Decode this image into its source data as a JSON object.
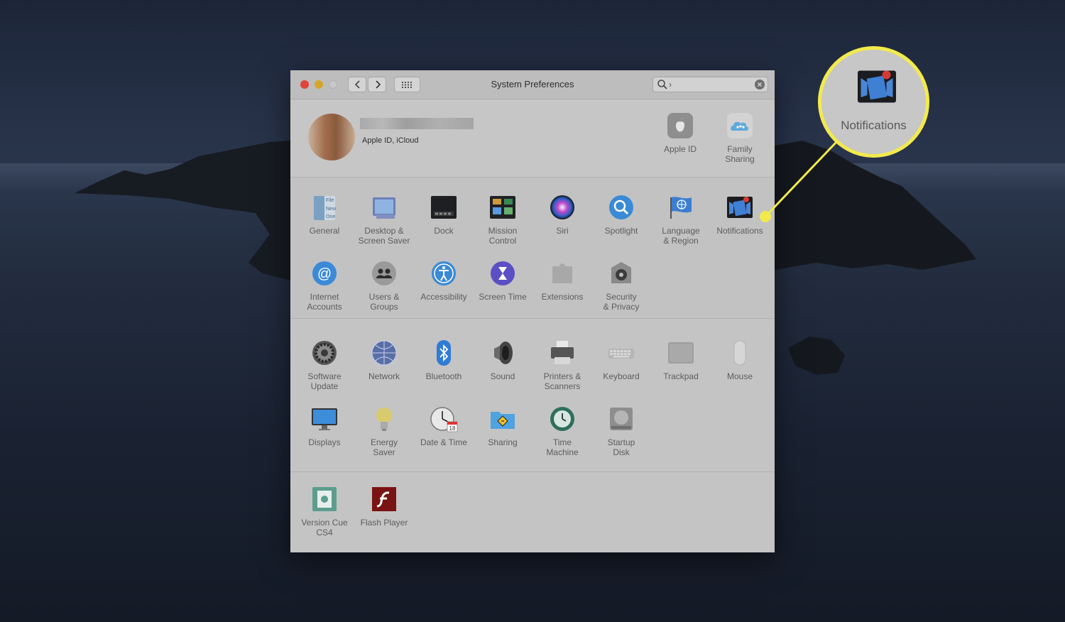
{
  "window": {
    "title": "System Preferences",
    "search_text": "›"
  },
  "account": {
    "subtitle": "Apple ID, iCloud",
    "items": [
      {
        "label": "Apple ID",
        "icon": "apple-logo-icon"
      },
      {
        "label": "Family\nSharing",
        "icon": "family-sharing-cloud-icon"
      }
    ]
  },
  "panes_row1": [
    {
      "label": "General",
      "icon": "general-icon"
    },
    {
      "label": "Desktop &\nScreen Saver",
      "icon": "desktop-screensaver-icon"
    },
    {
      "label": "Dock",
      "icon": "dock-icon"
    },
    {
      "label": "Mission\nControl",
      "icon": "mission-control-icon"
    },
    {
      "label": "Siri",
      "icon": "siri-icon"
    },
    {
      "label": "Spotlight",
      "icon": "spotlight-icon"
    },
    {
      "label": "Language\n& Region",
      "icon": "language-region-icon"
    },
    {
      "label": "Notifications",
      "icon": "notifications-icon"
    }
  ],
  "panes_row2": [
    {
      "label": "Internet\nAccounts",
      "icon": "internet-accounts-icon"
    },
    {
      "label": "Users &\nGroups",
      "icon": "users-groups-icon"
    },
    {
      "label": "Accessibility",
      "icon": "accessibility-icon"
    },
    {
      "label": "Screen Time",
      "icon": "screen-time-icon"
    },
    {
      "label": "Extensions",
      "icon": "extensions-icon"
    },
    {
      "label": "Security\n& Privacy",
      "icon": "security-privacy-icon"
    }
  ],
  "panes_row3": [
    {
      "label": "Software\nUpdate",
      "icon": "software-update-icon"
    },
    {
      "label": "Network",
      "icon": "network-icon"
    },
    {
      "label": "Bluetooth",
      "icon": "bluetooth-icon"
    },
    {
      "label": "Sound",
      "icon": "sound-icon"
    },
    {
      "label": "Printers &\nScanners",
      "icon": "printers-scanners-icon"
    },
    {
      "label": "Keyboard",
      "icon": "keyboard-icon"
    },
    {
      "label": "Trackpad",
      "icon": "trackpad-icon"
    },
    {
      "label": "Mouse",
      "icon": "mouse-icon"
    }
  ],
  "panes_row4": [
    {
      "label": "Displays",
      "icon": "displays-icon"
    },
    {
      "label": "Energy\nSaver",
      "icon": "energy-saver-icon"
    },
    {
      "label": "Date & Time",
      "icon": "date-time-icon",
      "badge": "18"
    },
    {
      "label": "Sharing",
      "icon": "sharing-icon"
    },
    {
      "label": "Time\nMachine",
      "icon": "time-machine-icon"
    },
    {
      "label": "Startup\nDisk",
      "icon": "startup-disk-icon"
    }
  ],
  "panes_row5": [
    {
      "label": "Version Cue\nCS4",
      "icon": "version-cue-icon"
    },
    {
      "label": "Flash Player",
      "icon": "flash-player-icon"
    }
  ],
  "general_icon_text": [
    "File",
    "New",
    "One"
  ],
  "callout": {
    "label": "Notifications",
    "icon": "notifications-icon",
    "highlight_color": "#f2ea4d"
  },
  "colors": {
    "close": "#e0443e",
    "minimize": "#d6a52b",
    "zoom": "#c8c8c8",
    "highlight": "#f2ea4d"
  }
}
